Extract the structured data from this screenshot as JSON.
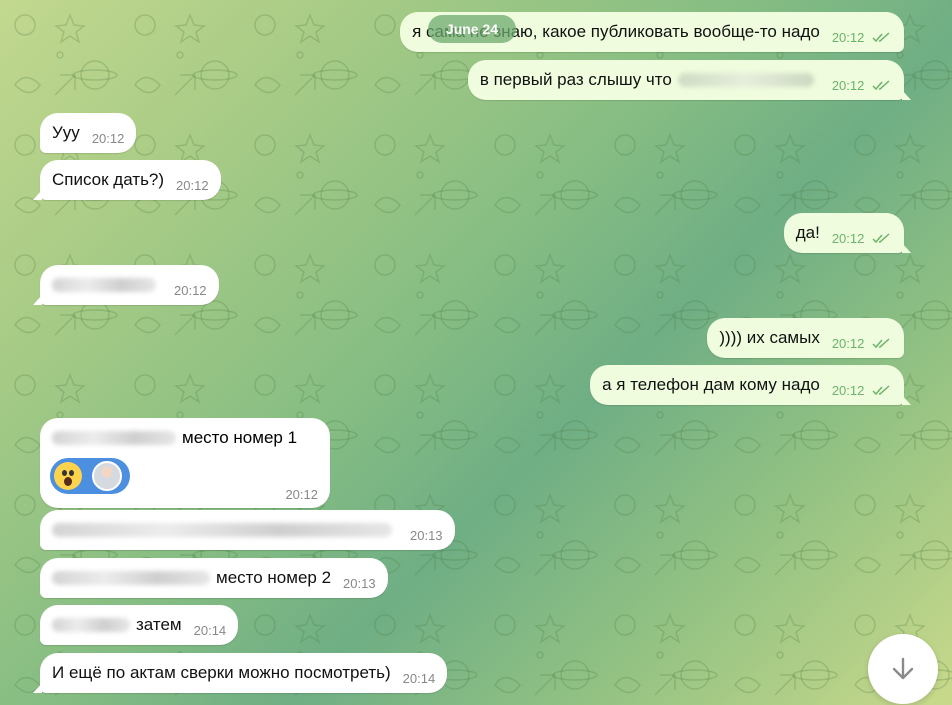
{
  "date_pill": "June 24",
  "messages_out": [
    {
      "text": "я сама не знаю, какое публиковать вообще-то надо",
      "time": "20:12"
    },
    {
      "text": "в первый раз слышу что",
      "time": "20:12"
    },
    {
      "text": "да!",
      "time": "20:12"
    },
    {
      "text": "))))  их самых",
      "time": "20:12"
    },
    {
      "text": "а я телефон дам  кому надо",
      "time": "20:12"
    }
  ],
  "messages_in": [
    {
      "text": "Ууу",
      "time": "20:12"
    },
    {
      "text": "Список дать?)",
      "time": "20:12"
    },
    {
      "text": "",
      "time": "20:12"
    },
    {
      "text": "место номер 1",
      "time": "20:12"
    },
    {
      "text": "",
      "time": "20:13"
    },
    {
      "text": "место номер 2",
      "time": "20:13"
    },
    {
      "text": "затем",
      "time": "20:14"
    },
    {
      "text": "И ещё по актам сверки можно посмотреть)",
      "time": "20:14"
    }
  ],
  "icons": {
    "read_receipt": "double-check-icon",
    "scroll_down": "arrow-down-icon",
    "reaction_emoji": "scream-emoji-icon",
    "reaction_avatar": "user-avatar-icon"
  },
  "colors": {
    "outgoing_bubble": "#effdde",
    "incoming_bubble": "#ffffff",
    "check_color": "#6cb36b",
    "reaction_pill": "#4c8ee0"
  }
}
